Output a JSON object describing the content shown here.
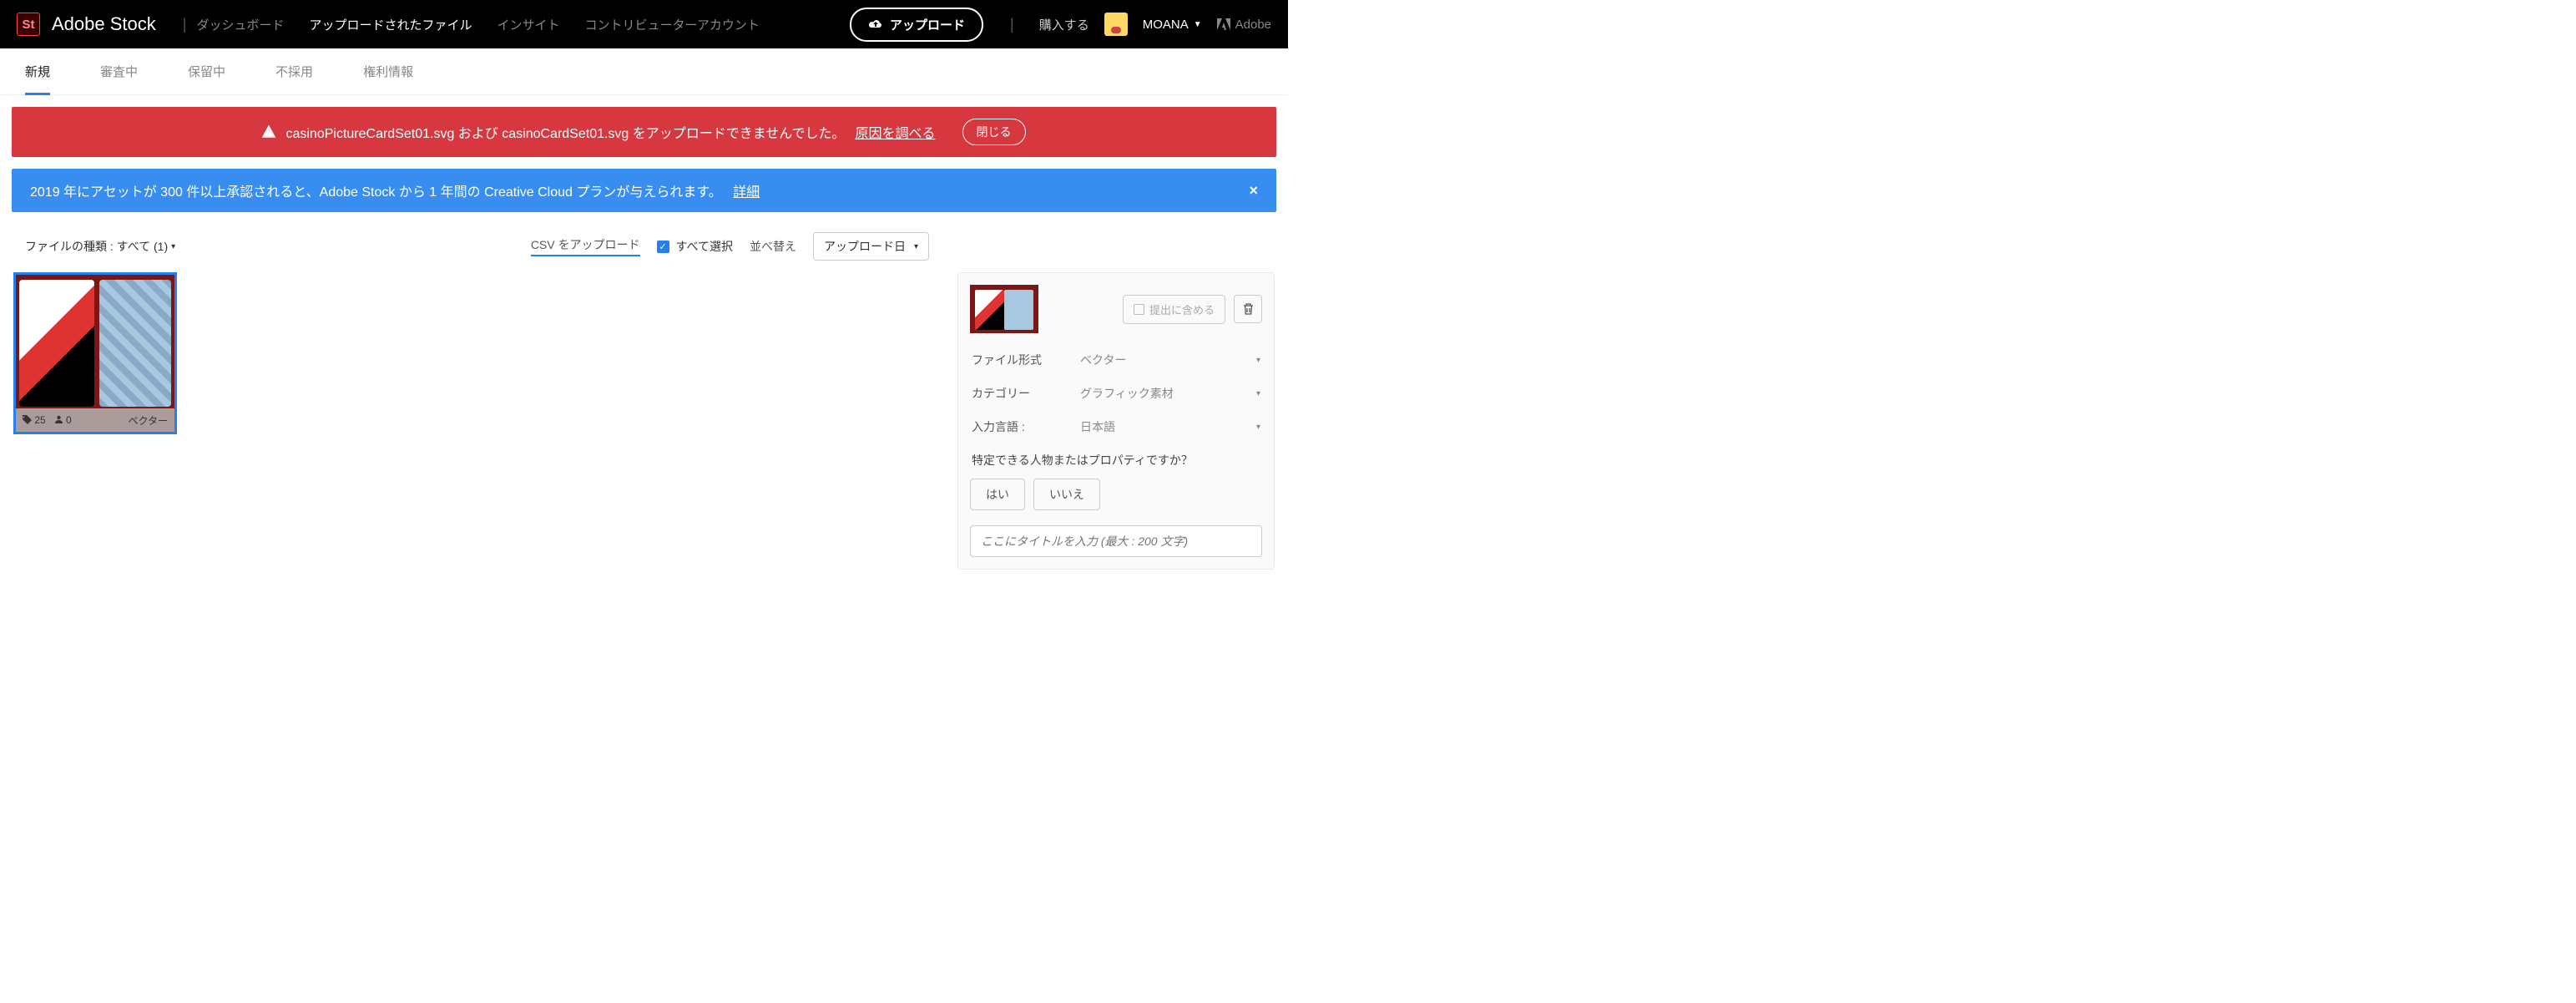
{
  "header": {
    "logo_badge": "St",
    "logo_text": "Adobe Stock",
    "nav": {
      "dashboard": "ダッシュボード",
      "uploaded": "アップロードされたファイル",
      "insights": "インサイト",
      "contributor": "コントリビューターアカウント"
    },
    "upload_button": "アップロード",
    "buy": "購入する",
    "user": "MOANA",
    "adobe_link": "Adobe"
  },
  "subnav": {
    "new": "新規",
    "reviewing": "審査中",
    "pending": "保留中",
    "rejected": "不採用",
    "rights": "権利情報"
  },
  "alerts": {
    "error_text": "casinoPictureCardSet01.svg および casinoCardSet01.svg をアップロードできませんでした。",
    "error_link": "原因を調べる",
    "error_close": "閉じる",
    "info_text": "2019 年にアセットが 300 件以上承認されると、Adobe Stock から 1 年間の Creative Cloud プランが与えられます。",
    "info_link": "詳細"
  },
  "toolbar": {
    "filter": "ファイルの種類 : すべて (1)",
    "csv": "CSV をアップロード",
    "select_all": "すべて選択",
    "sort_label": "並べ替え",
    "sort_value": "アップロード日"
  },
  "thumb": {
    "tags": "25",
    "people": "0",
    "type": "ベクター"
  },
  "sidebar": {
    "submit": "提出に含める",
    "fields": {
      "format_label": "ファイル形式",
      "format_value": "ベクター",
      "category_label": "カテゴリー",
      "category_value": "グラフィック素材",
      "lang_label": "入力言語 :",
      "lang_value": "日本語"
    },
    "question": "特定できる人物またはプロパティですか？",
    "yes": "はい",
    "no": "いいえ",
    "title_placeholder": "ここにタイトルを入力 (最大 : 200 文字)"
  }
}
